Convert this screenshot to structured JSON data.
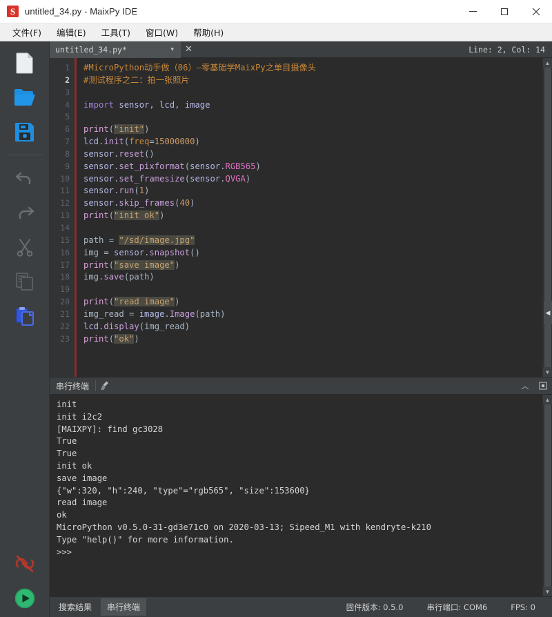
{
  "window": {
    "title": "untitled_34.py - MaixPy IDE",
    "logo_letter": "S",
    "controls": {
      "minimize": "minimize-icon",
      "maximize": "maximize-icon",
      "close": "close-icon"
    }
  },
  "menubar": {
    "items": [
      {
        "label": "文件(F)",
        "name": "menu-file"
      },
      {
        "label": "编辑(E)",
        "name": "menu-edit"
      },
      {
        "label": "工具(T)",
        "name": "menu-tools"
      },
      {
        "label": "窗口(W)",
        "name": "menu-window"
      },
      {
        "label": "帮助(H)",
        "name": "menu-help"
      }
    ]
  },
  "toolbar": {
    "items": [
      {
        "name": "new-file-icon",
        "label": "New File",
        "enabled": true
      },
      {
        "name": "open-folder-icon",
        "label": "Open File",
        "enabled": true
      },
      {
        "name": "save-icon",
        "label": "Save",
        "enabled": true
      },
      {
        "name": "undo-icon",
        "label": "Undo",
        "enabled": false
      },
      {
        "name": "redo-icon",
        "label": "Redo",
        "enabled": false
      },
      {
        "name": "cut-icon",
        "label": "Cut",
        "enabled": false
      },
      {
        "name": "copy-icon",
        "label": "Copy",
        "enabled": false
      },
      {
        "name": "paste-icon",
        "label": "Paste",
        "enabled": true
      },
      {
        "name": "disconnect-icon",
        "label": "Disconnect",
        "enabled": true
      },
      {
        "name": "run-icon",
        "label": "Run",
        "enabled": true
      }
    ]
  },
  "tabbar": {
    "tab_label": "untitled_34.py*",
    "caret": "▾",
    "close": "✕",
    "cursor_position": "Line: 2, Col: 14"
  },
  "editor": {
    "line_numbers": [
      "1",
      "2",
      "3",
      "4",
      "5",
      "6",
      "7",
      "8",
      "9",
      "10",
      "11",
      "12",
      "13",
      "14",
      "15",
      "16",
      "17",
      "18",
      "19",
      "20",
      "21",
      "22",
      "23"
    ],
    "current_line": 2,
    "lines": [
      {
        "n": 1,
        "tokens": [
          {
            "t": "#MicroPython动手做（06）—零基础学MaixPy之单目摄像头",
            "c": "c-com"
          }
        ]
      },
      {
        "n": 2,
        "tokens": [
          {
            "t": "#测试程序之二：拍一张照片",
            "c": "c-com"
          }
        ]
      },
      {
        "n": 3,
        "tokens": []
      },
      {
        "n": 4,
        "tokens": [
          {
            "t": "import",
            "c": "c-kw"
          },
          {
            "t": " ",
            "c": "c-punc"
          },
          {
            "t": "sensor",
            "c": "c-var"
          },
          {
            "t": ", ",
            "c": "c-punc"
          },
          {
            "t": "lcd",
            "c": "c-var"
          },
          {
            "t": ", ",
            "c": "c-punc"
          },
          {
            "t": "image",
            "c": "c-var"
          }
        ]
      },
      {
        "n": 5,
        "tokens": []
      },
      {
        "n": 6,
        "tokens": [
          {
            "t": "print",
            "c": "c-fn"
          },
          {
            "t": "(",
            "c": "c-punc"
          },
          {
            "t": "\"init\"",
            "c": "c-str"
          },
          {
            "t": ")",
            "c": "c-punc"
          }
        ]
      },
      {
        "n": 7,
        "tokens": [
          {
            "t": "lcd",
            "c": "c-var"
          },
          {
            "t": ".",
            "c": "c-punc"
          },
          {
            "t": "init",
            "c": "c-meth"
          },
          {
            "t": "(",
            "c": "c-punc"
          },
          {
            "t": "freq",
            "c": "c-kwarg"
          },
          {
            "t": "=",
            "c": "c-punc"
          },
          {
            "t": "15000000",
            "c": "c-num"
          },
          {
            "t": ")",
            "c": "c-punc"
          }
        ]
      },
      {
        "n": 8,
        "tokens": [
          {
            "t": "sensor",
            "c": "c-var"
          },
          {
            "t": ".",
            "c": "c-punc"
          },
          {
            "t": "reset",
            "c": "c-meth"
          },
          {
            "t": "()",
            "c": "c-punc"
          }
        ]
      },
      {
        "n": 9,
        "tokens": [
          {
            "t": "sensor",
            "c": "c-var"
          },
          {
            "t": ".",
            "c": "c-punc"
          },
          {
            "t": "set_pixformat",
            "c": "c-meth"
          },
          {
            "t": "(",
            "c": "c-punc"
          },
          {
            "t": "sensor",
            "c": "c-var"
          },
          {
            "t": ".",
            "c": "c-punc"
          },
          {
            "t": "RGB565",
            "c": "c-const"
          },
          {
            "t": ")",
            "c": "c-punc"
          }
        ]
      },
      {
        "n": 10,
        "tokens": [
          {
            "t": "sensor",
            "c": "c-var"
          },
          {
            "t": ".",
            "c": "c-punc"
          },
          {
            "t": "set_framesize",
            "c": "c-meth"
          },
          {
            "t": "(",
            "c": "c-punc"
          },
          {
            "t": "sensor",
            "c": "c-var"
          },
          {
            "t": ".",
            "c": "c-punc"
          },
          {
            "t": "QVGA",
            "c": "c-const"
          },
          {
            "t": ")",
            "c": "c-punc"
          }
        ]
      },
      {
        "n": 11,
        "tokens": [
          {
            "t": "sensor",
            "c": "c-var"
          },
          {
            "t": ".",
            "c": "c-punc"
          },
          {
            "t": "run",
            "c": "c-meth"
          },
          {
            "t": "(",
            "c": "c-punc"
          },
          {
            "t": "1",
            "c": "c-num"
          },
          {
            "t": ")",
            "c": "c-punc"
          }
        ]
      },
      {
        "n": 12,
        "tokens": [
          {
            "t": "sensor",
            "c": "c-var"
          },
          {
            "t": ".",
            "c": "c-punc"
          },
          {
            "t": "skip_frames",
            "c": "c-meth"
          },
          {
            "t": "(",
            "c": "c-punc"
          },
          {
            "t": "40",
            "c": "c-num"
          },
          {
            "t": ")",
            "c": "c-punc"
          }
        ]
      },
      {
        "n": 13,
        "tokens": [
          {
            "t": "print",
            "c": "c-fn"
          },
          {
            "t": "(",
            "c": "c-punc"
          },
          {
            "t": "\"init ok\"",
            "c": "c-str"
          },
          {
            "t": ")",
            "c": "c-punc"
          }
        ]
      },
      {
        "n": 14,
        "tokens": []
      },
      {
        "n": 15,
        "tokens": [
          {
            "t": "path",
            "c": "c-id"
          },
          {
            "t": " = ",
            "c": "c-punc"
          },
          {
            "t": "\"/sd/image.jpg\"",
            "c": "c-str"
          }
        ]
      },
      {
        "n": 16,
        "tokens": [
          {
            "t": "img",
            "c": "c-id"
          },
          {
            "t": " = ",
            "c": "c-punc"
          },
          {
            "t": "sensor",
            "c": "c-var"
          },
          {
            "t": ".",
            "c": "c-punc"
          },
          {
            "t": "snapshot",
            "c": "c-meth"
          },
          {
            "t": "()",
            "c": "c-punc"
          }
        ]
      },
      {
        "n": 17,
        "tokens": [
          {
            "t": "print",
            "c": "c-fn"
          },
          {
            "t": "(",
            "c": "c-punc"
          },
          {
            "t": "\"save image\"",
            "c": "c-str"
          },
          {
            "t": ")",
            "c": "c-punc"
          }
        ]
      },
      {
        "n": 18,
        "tokens": [
          {
            "t": "img",
            "c": "c-id"
          },
          {
            "t": ".",
            "c": "c-punc"
          },
          {
            "t": "save",
            "c": "c-meth"
          },
          {
            "t": "(",
            "c": "c-punc"
          },
          {
            "t": "path",
            "c": "c-id"
          },
          {
            "t": ")",
            "c": "c-punc"
          }
        ]
      },
      {
        "n": 19,
        "tokens": []
      },
      {
        "n": 20,
        "tokens": [
          {
            "t": "print",
            "c": "c-fn"
          },
          {
            "t": "(",
            "c": "c-punc"
          },
          {
            "t": "\"read image\"",
            "c": "c-str"
          },
          {
            "t": ")",
            "c": "c-punc"
          }
        ]
      },
      {
        "n": 21,
        "tokens": [
          {
            "t": "img_read",
            "c": "c-id"
          },
          {
            "t": " = ",
            "c": "c-punc"
          },
          {
            "t": "image",
            "c": "c-var"
          },
          {
            "t": ".",
            "c": "c-punc"
          },
          {
            "t": "Image",
            "c": "c-meth"
          },
          {
            "t": "(",
            "c": "c-punc"
          },
          {
            "t": "path",
            "c": "c-id"
          },
          {
            "t": ")",
            "c": "c-punc"
          }
        ]
      },
      {
        "n": 22,
        "tokens": [
          {
            "t": "lcd",
            "c": "c-var"
          },
          {
            "t": ".",
            "c": "c-punc"
          },
          {
            "t": "display",
            "c": "c-meth"
          },
          {
            "t": "(",
            "c": "c-punc"
          },
          {
            "t": "img_read",
            "c": "c-id"
          },
          {
            "t": ")",
            "c": "c-punc"
          }
        ]
      },
      {
        "n": 23,
        "tokens": [
          {
            "t": "print",
            "c": "c-fn"
          },
          {
            "t": "(",
            "c": "c-punc"
          },
          {
            "t": "\"ok\"",
            "c": "c-str"
          },
          {
            "t": ")",
            "c": "c-punc"
          }
        ]
      }
    ]
  },
  "terminal": {
    "title": "串行终端",
    "clear_icon": "broom-icon",
    "collapse_icon": "chevron-up-icon",
    "float_icon": "restore-icon",
    "output": [
      "init",
      "init i2c2",
      "[MAIXPY]: find gc3028",
      "True",
      "True",
      "init ok",
      "save image",
      "{\"w\":320, \"h\":240, \"type\"=\"rgb565\", \"size\":153600}",
      "read image",
      "ok",
      "MicroPython v0.5.0-31-gd3e71c0 on 2020-03-13; Sipeed_M1 with kendryte-k210",
      "Type \"help()\" for more information.",
      ">>>"
    ]
  },
  "statusbar": {
    "tabs": [
      {
        "label": "搜索结果",
        "name": "status-tab-search-results",
        "active": false
      },
      {
        "label": "串行终端",
        "name": "status-tab-serial-terminal",
        "active": true
      }
    ],
    "firmware": "固件版本: 0.5.0",
    "serial_port": "串行端口: COM6",
    "fps": "FPS: 0"
  },
  "colors": {
    "accent_blue": "#1e8fe0",
    "run_green": "#2eb872",
    "disconnect_red": "#c0392b",
    "editor_bg": "#2b2b2b",
    "chrome_bg": "#3c3f41"
  }
}
